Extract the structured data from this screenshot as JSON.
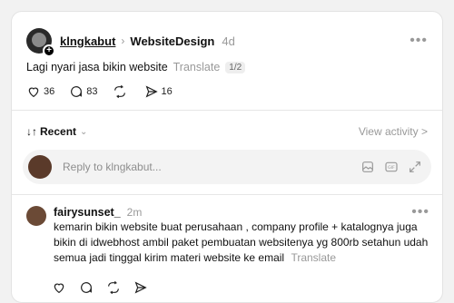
{
  "post": {
    "author": "klngkabut",
    "topic": "WebsiteDesign",
    "time": "4d",
    "text": "Lagi nyari jasa bikin website",
    "translate": "Translate",
    "page_indicator": "1/2",
    "likes": "36",
    "comments": "83",
    "reposts": "",
    "shares": "16"
  },
  "thread": {
    "sort_label": "Recent",
    "view_activity": "View activity >"
  },
  "reply": {
    "placeholder": "Reply to klngkabut..."
  },
  "comment": {
    "author": "fairysunset_",
    "time": "2m",
    "text": "kemarin bikin website buat perusahaan , company profile + katalognya juga bikin di idwebhost ambil paket pembuatan websitenya yg 800rb setahun udah semua jadi tinggal kirim materi website ke email",
    "translate": "Translate"
  },
  "icons": {
    "more": "more-icon",
    "like": "heart-icon",
    "comment": "comment-icon",
    "repost": "repost-icon",
    "share": "share-icon",
    "gif": "gif-icon",
    "image": "image-icon",
    "expand": "expand-icon"
  }
}
